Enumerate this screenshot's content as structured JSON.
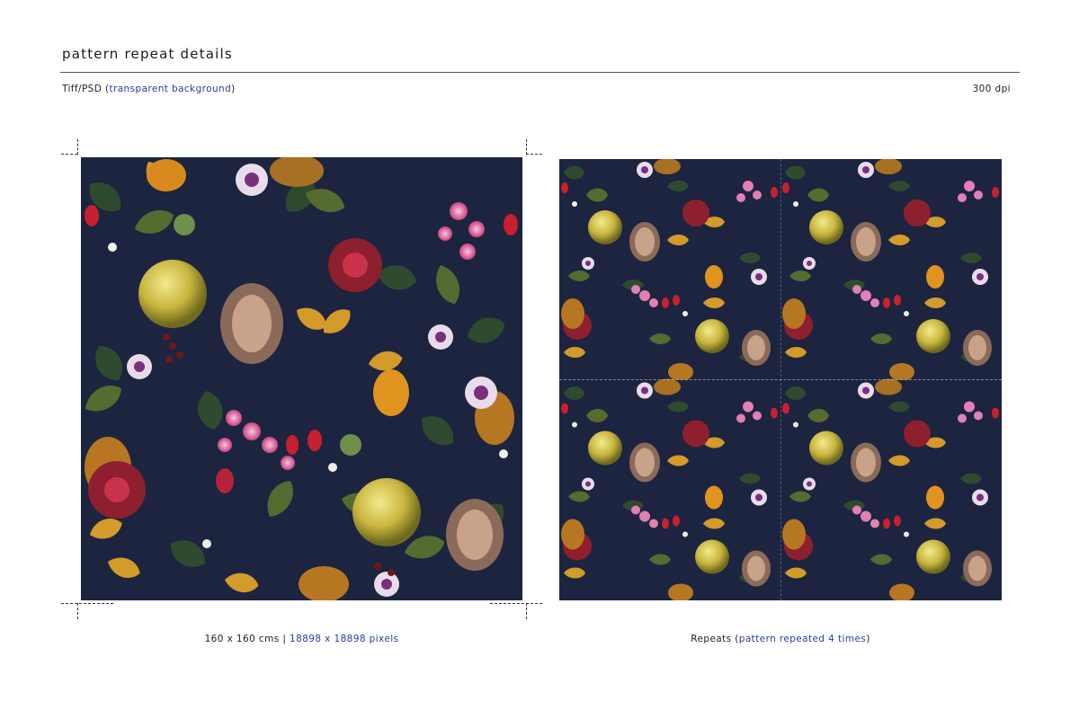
{
  "header": {
    "title": "pattern repeat details",
    "format_label": "Tiff/PSD",
    "format_note": "transparent background",
    "dpi": "300 dpi"
  },
  "left_panel": {
    "size_text": "160 x 160 cms",
    "separator": "|",
    "pixels_text": "18898 x 18898 pixels"
  },
  "right_panel": {
    "label": "Repeats",
    "note": "pattern repeated 4 times"
  },
  "colors": {
    "accent": "#2b3aa8",
    "pattern_background": "#1c2440"
  }
}
